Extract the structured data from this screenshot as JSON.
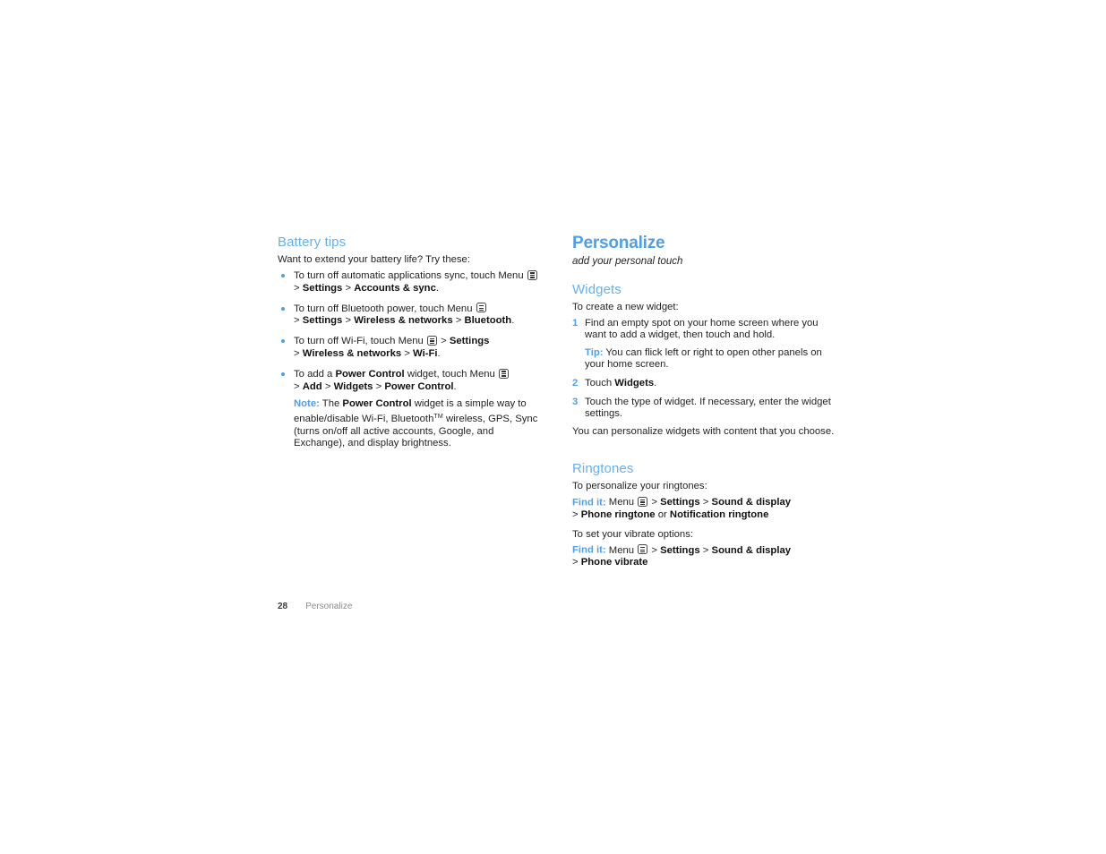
{
  "page": {
    "number": "28",
    "chapter_footer": "Personalize"
  },
  "colors": {
    "title_blue": "#4f9ee8",
    "section_blue": "#66b0ee",
    "body_text": "#232323",
    "footer_gray": "#8c8c8c"
  },
  "icons": {
    "menu_key": "menu-key-icon"
  },
  "left_column": {
    "section_title": "Battery tips",
    "intro": "Want to extend your battery life? Try these:",
    "bullets": [
      {
        "segments": [
          {
            "text": "To turn off automatic applications sync, touch Menu ",
            "style": "normal"
          },
          {
            "text": "menu-key-icon",
            "style": "icon"
          },
          {
            "text": " > ",
            "style": "normal"
          },
          {
            "text": "Settings",
            "style": "bold"
          },
          {
            "text": " > ",
            "style": "normal"
          },
          {
            "text": "Accounts & sync",
            "style": "bold"
          },
          {
            "text": ".",
            "style": "normal"
          }
        ]
      },
      {
        "segments": [
          {
            "text": "To turn off Bluetooth power, touch Menu ",
            "style": "normal"
          },
          {
            "text": "menu-key-icon",
            "style": "icon"
          },
          {
            "text": " > ",
            "style": "normal"
          },
          {
            "text": "Settings",
            "style": "bold"
          },
          {
            "text": " > ",
            "style": "normal"
          },
          {
            "text": "Wireless & networks",
            "style": "bold"
          },
          {
            "text": " > ",
            "style": "normal"
          },
          {
            "text": "Bluetooth",
            "style": "bold"
          },
          {
            "text": ".",
            "style": "normal"
          }
        ]
      },
      {
        "segments": [
          {
            "text": "To turn off Wi-Fi, touch Menu ",
            "style": "normal"
          },
          {
            "text": "menu-key-icon",
            "style": "icon"
          },
          {
            "text": " > ",
            "style": "normal"
          },
          {
            "text": "Settings",
            "style": "bold"
          },
          {
            "text": " > ",
            "style": "normal"
          },
          {
            "text": "Wireless & networks",
            "style": "bold"
          },
          {
            "text": " > ",
            "style": "normal"
          },
          {
            "text": "Wi-Fi",
            "style": "bold"
          },
          {
            "text": ".",
            "style": "normal"
          }
        ]
      },
      {
        "segments": [
          {
            "text": "To add a ",
            "style": "normal"
          },
          {
            "text": "Power Control",
            "style": "bold"
          },
          {
            "text": " widget, touch Menu ",
            "style": "normal"
          },
          {
            "text": "menu-key-icon",
            "style": "icon"
          },
          {
            "text": " > ",
            "style": "normal"
          },
          {
            "text": "Add",
            "style": "bold"
          },
          {
            "text": " > ",
            "style": "normal"
          },
          {
            "text": "Widgets",
            "style": "bold"
          },
          {
            "text": " > ",
            "style": "normal"
          },
          {
            "text": "Power Control",
            "style": "bold"
          },
          {
            "text": ".",
            "style": "normal"
          }
        ]
      }
    ],
    "note": {
      "label": "Note:",
      "body_before": " The ",
      "bold_term": "Power Control",
      "body_after": " widget is a simple way to enable/disable Wi-Fi, Bluetooth",
      "trademark": "TM",
      "body_tail": " wireless, GPS, Sync (turns on/off all active accounts, Google, and Exchange), and display brightness."
    }
  },
  "right_column": {
    "chapter_title": "Personalize",
    "chapter_subtitle": "add your personal touch",
    "widgets": {
      "title": "Widgets",
      "intro": "To create a new widget:",
      "steps": [
        {
          "num": "1",
          "text": "Find an empty spot on your home screen where you want to add a widget, then touch and hold."
        },
        {
          "num": "2",
          "segments": [
            {
              "text": "Touch ",
              "style": "normal"
            },
            {
              "text": "Widgets",
              "style": "bold"
            },
            {
              "text": ".",
              "style": "normal"
            }
          ]
        },
        {
          "num": "3",
          "text": "Touch the type of widget. If necessary, enter the widget settings."
        }
      ],
      "tip": {
        "label": "Tip:",
        "text": " You can flick left or right to open other panels on your home screen."
      },
      "outro": "You can personalize widgets with content that you choose."
    },
    "ringtones": {
      "title": "Ringtones",
      "intro_1": "To personalize your ringtones:",
      "findit_1": {
        "label": "Find it:",
        "segments": [
          {
            "text": " Menu ",
            "style": "normal"
          },
          {
            "text": "menu-key-icon",
            "style": "icon"
          },
          {
            "text": " > ",
            "style": "normal"
          },
          {
            "text": "Settings",
            "style": "bold"
          },
          {
            "text": " > ",
            "style": "normal"
          },
          {
            "text": "Sound & display",
            "style": "bold"
          },
          {
            "text": " > ",
            "style": "normal"
          },
          {
            "text": "Phone ringtone",
            "style": "bold"
          },
          {
            "text": " or ",
            "style": "normal"
          },
          {
            "text": "Notification ringtone",
            "style": "bold"
          }
        ]
      },
      "intro_2": "To set your vibrate options:",
      "findit_2": {
        "label": "Find it:",
        "segments": [
          {
            "text": " Menu ",
            "style": "normal"
          },
          {
            "text": "menu-key-icon",
            "style": "icon"
          },
          {
            "text": " > ",
            "style": "normal"
          },
          {
            "text": "Settings",
            "style": "bold"
          },
          {
            "text": " > ",
            "style": "normal"
          },
          {
            "text": "Sound & display",
            "style": "bold"
          },
          {
            "text": " > ",
            "style": "normal"
          },
          {
            "text": "Phone vibrate",
            "style": "bold"
          }
        ]
      }
    }
  }
}
